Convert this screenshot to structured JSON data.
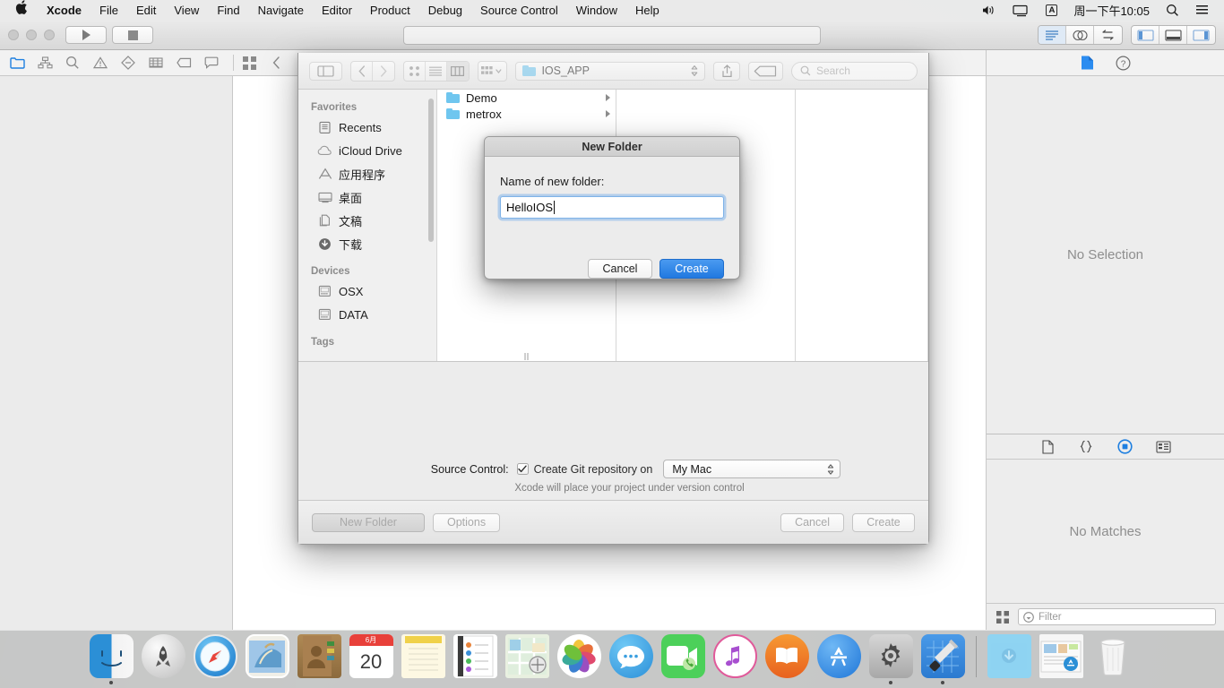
{
  "menubar": {
    "apple_icon": "apple-logo-icon",
    "items": [
      {
        "label": "Xcode",
        "bold": true
      },
      {
        "label": "File",
        "bold": false
      },
      {
        "label": "Edit",
        "bold": false
      },
      {
        "label": "View",
        "bold": false
      },
      {
        "label": "Find",
        "bold": false
      },
      {
        "label": "Navigate",
        "bold": false
      },
      {
        "label": "Editor",
        "bold": false
      },
      {
        "label": "Product",
        "bold": false
      },
      {
        "label": "Debug",
        "bold": false
      },
      {
        "label": "Source Control",
        "bold": false
      },
      {
        "label": "Window",
        "bold": false
      },
      {
        "label": "Help",
        "bold": false
      }
    ],
    "status": {
      "volume_icon": "speaker-icon",
      "airplay_icon": "airplay-display-icon",
      "input_badge": "A",
      "clock": "周一下午10:05",
      "search_icon": "spotlight-search-icon",
      "notification_icon": "notification-center-icon"
    }
  },
  "xcode": {
    "toolbar": {
      "run_icon": "play-icon",
      "stop_icon": "stop-icon",
      "status_text": "",
      "editor_modes": [
        "standard-editor-icon",
        "assistant-editor-icon",
        "version-editor-icon"
      ],
      "panel_toggles": [
        "toggle-navigator-icon",
        "toggle-debug-area-icon",
        "toggle-utilities-icon"
      ]
    },
    "navigator_icons": [
      "project-navigator-icon",
      "symbol-navigator-icon",
      "find-navigator-icon",
      "issue-navigator-icon",
      "test-navigator-icon",
      "debug-navigator-icon",
      "breakpoint-navigator-icon",
      "report-navigator-icon"
    ],
    "navigator_extra": [
      "grid-view-icon",
      "chevron-left-icon"
    ],
    "inspector": {
      "tabs": [
        "file-inspector-icon",
        "quick-help-icon"
      ],
      "empty_text": "No Selection",
      "library_tabs": [
        "file-template-library-icon",
        "code-snippet-library-icon",
        "object-library-icon",
        "media-library-icon"
      ],
      "library_empty_text": "No Matches",
      "filter_placeholder": "Filter",
      "filter_value": "",
      "grid_icon": "library-grid-icon"
    }
  },
  "save_panel": {
    "toolbar": {
      "sidebar_toggle_icon": "toggle-sidebar-icon",
      "back_icon": "chevron-left-icon",
      "forward_icon": "chevron-right-icon",
      "view_modes": [
        "icon-view-icon",
        "list-view-icon",
        "column-view-icon"
      ],
      "active_view_mode": "column-view-icon",
      "arrange_icon": "arrange-by-icon",
      "path_label": "IOS_APP",
      "path_folder_icon": "folder-icon",
      "path_stepper_icon": "stepper-updown-icon",
      "share_icon": "share-icon",
      "tag_icon": "tag-icon",
      "search_icon": "search-icon",
      "search_placeholder": "Search",
      "search_value": ""
    },
    "sidebar": [
      {
        "header": "Favorites",
        "items": [
          {
            "label": "Recents",
            "icon": "recents-icon"
          },
          {
            "label": "iCloud Drive",
            "icon": "icloud-icon"
          },
          {
            "label": "应用程序",
            "icon": "applications-icon"
          },
          {
            "label": "桌面",
            "icon": "desktop-icon"
          },
          {
            "label": "文稿",
            "icon": "documents-icon"
          },
          {
            "label": "下载",
            "icon": "downloads-icon"
          }
        ]
      },
      {
        "header": "Devices",
        "items": [
          {
            "label": "OSX",
            "icon": "hard-disk-icon"
          },
          {
            "label": "DATA",
            "icon": "hard-disk-icon"
          }
        ]
      },
      {
        "header": "Tags",
        "items": []
      }
    ],
    "column_items": [
      {
        "label": "Demo",
        "icon": "folder-icon",
        "has_children": true
      },
      {
        "label": "metrox",
        "icon": "folder-icon",
        "has_children": true
      }
    ],
    "options": {
      "source_control_label": "Source Control:",
      "git_checkbox_label": "Create Git repository on",
      "git_checkbox_checked": true,
      "git_location": "My Mac",
      "note": "Xcode will place your project under version control"
    },
    "footer": {
      "new_folder_label": "New Folder",
      "options_label": "Options",
      "cancel_label": "Cancel",
      "create_label": "Create"
    }
  },
  "new_folder_dialog": {
    "title": "New Folder",
    "field_label": "Name of new folder:",
    "field_value": "HelloIOS",
    "cancel_label": "Cancel",
    "create_label": "Create"
  },
  "dock": {
    "items": [
      {
        "name": "finder",
        "label": "Finder",
        "running": true
      },
      {
        "name": "launchpad",
        "label": "Launchpad",
        "running": false
      },
      {
        "name": "safari",
        "label": "Safari",
        "running": false
      },
      {
        "name": "mail",
        "label": "Mail",
        "running": false
      },
      {
        "name": "contacts",
        "label": "Contacts",
        "running": false
      },
      {
        "name": "calendar",
        "label": "Calendar",
        "running": false,
        "day": "20",
        "month": "6月"
      },
      {
        "name": "notes",
        "label": "Notes",
        "running": false
      },
      {
        "name": "reminders",
        "label": "Reminders",
        "running": false
      },
      {
        "name": "maps",
        "label": "Maps",
        "running": false
      },
      {
        "name": "photos",
        "label": "Photos",
        "running": false
      },
      {
        "name": "messages",
        "label": "Messages",
        "running": false
      },
      {
        "name": "facetime",
        "label": "FaceTime",
        "running": false
      },
      {
        "name": "itunes",
        "label": "iTunes",
        "running": false
      },
      {
        "name": "ibooks",
        "label": "iBooks",
        "running": false
      },
      {
        "name": "appstore",
        "label": "App Store",
        "running": false
      },
      {
        "name": "system-preferences",
        "label": "System Preferences",
        "running": true
      },
      {
        "name": "xcode",
        "label": "Xcode",
        "running": true
      }
    ],
    "stacks": [
      {
        "name": "downloads-folder",
        "label": "Downloads"
      },
      {
        "name": "documents-stack",
        "label": "Stack"
      },
      {
        "name": "trash",
        "label": "Trash"
      }
    ]
  },
  "colors": {
    "accent_blue": "#2179e0",
    "folder_blue": "#6fc6ef",
    "selected_icon_blue": "#1e7fe0",
    "menubar_bg": "#f8f8f8",
    "panel_bg": "#ececec"
  }
}
